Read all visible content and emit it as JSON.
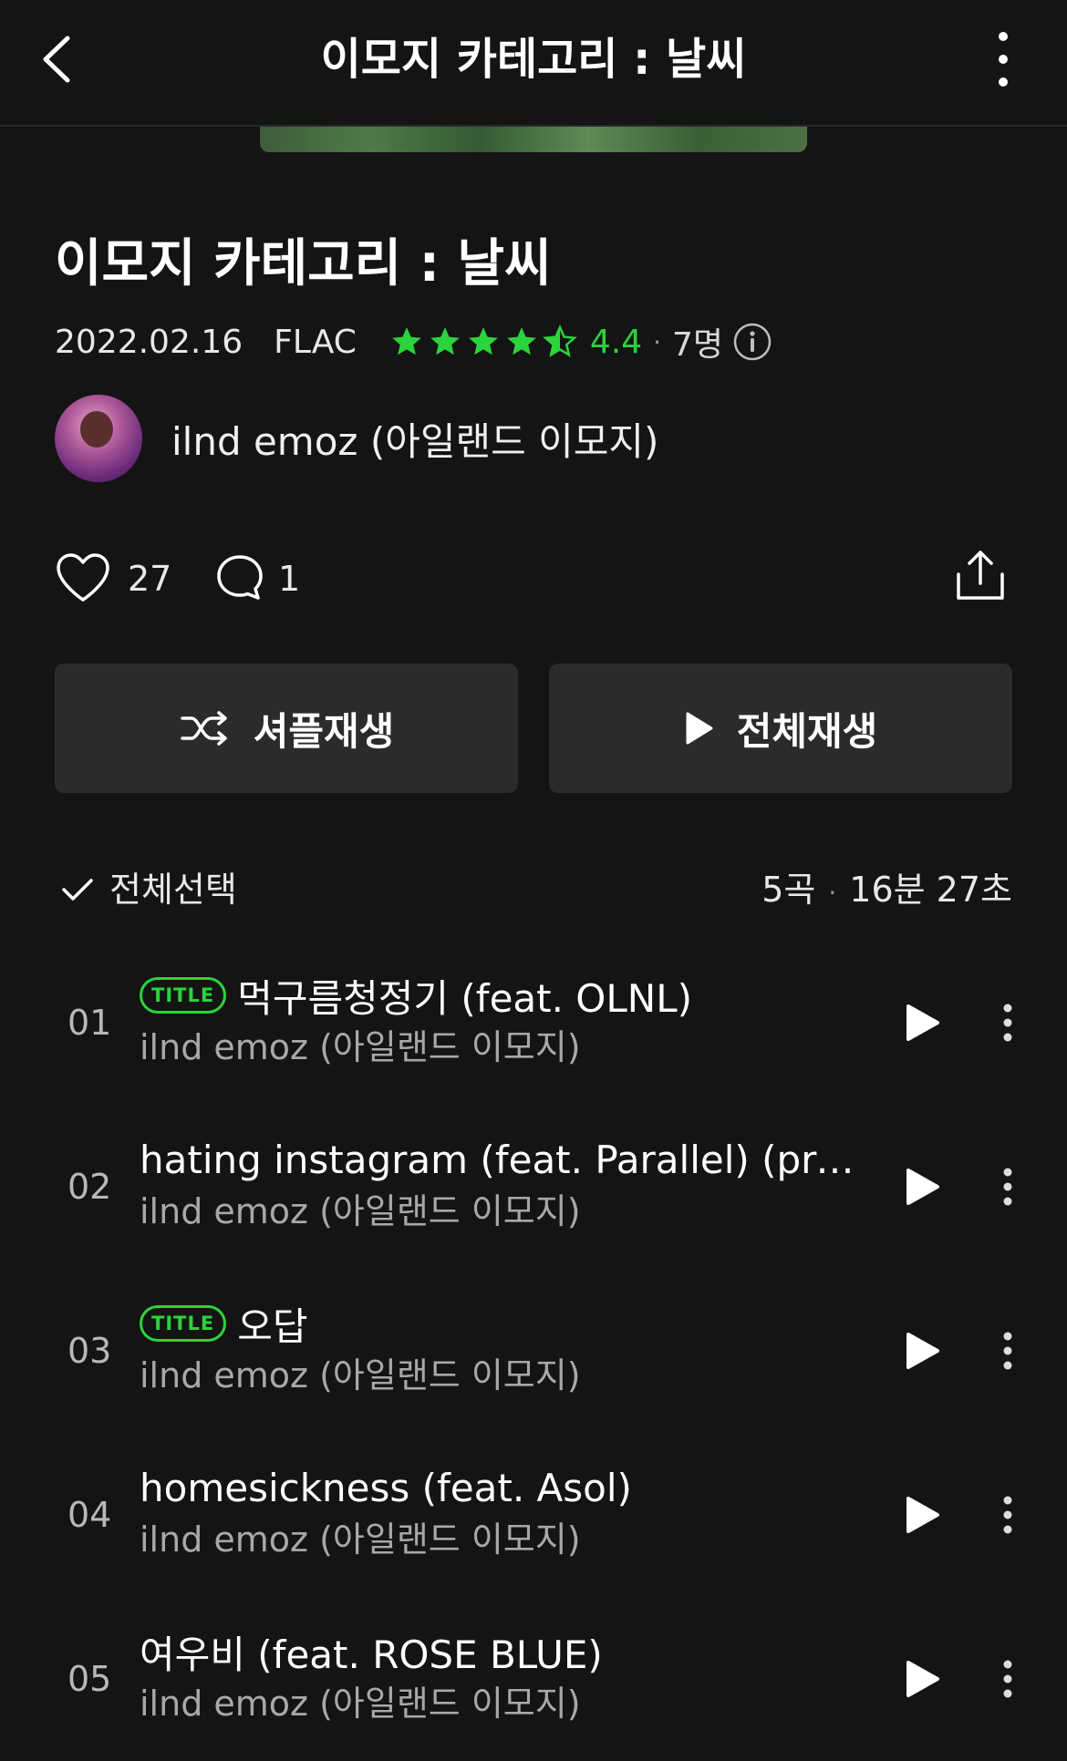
{
  "header": {
    "title": "이모지 카테고리 : 날씨"
  },
  "album": {
    "title": "이모지 카테고리 : 날씨",
    "date": "2022.02.16",
    "format": "FLAC",
    "rating": "4.4",
    "rating_value": 4.4,
    "rater_count": "7명",
    "accent_color": "#2bd33c",
    "artist": "ilnd emoz (아일랜드 이모지)"
  },
  "social": {
    "likes": "27",
    "comments": "1"
  },
  "buttons": {
    "shuffle": "셔플재생",
    "play_all": "전체재생"
  },
  "list_header": {
    "select_all": "전체선택",
    "count": "5곡",
    "duration": "16분 27초"
  },
  "tracks": [
    {
      "num": "01",
      "badge": "TITLE",
      "title": "먹구름청정기 (feat. OLNL)",
      "artist": "ilnd emoz (아일랜드 이모지)"
    },
    {
      "num": "02",
      "badge": "",
      "title": "hating instagram (feat. Parallel) (prod...",
      "artist": "ilnd emoz (아일랜드 이모지)"
    },
    {
      "num": "03",
      "badge": "TITLE",
      "title": "오답",
      "artist": "ilnd emoz (아일랜드 이모지)"
    },
    {
      "num": "04",
      "badge": "",
      "title": "homesickness (feat. Asol)",
      "artist": "ilnd emoz (아일랜드 이모지)"
    },
    {
      "num": "05",
      "badge": "",
      "title": "여우비 (feat. ROSE BLUE)",
      "artist": "ilnd emoz (아일랜드 이모지)"
    }
  ]
}
